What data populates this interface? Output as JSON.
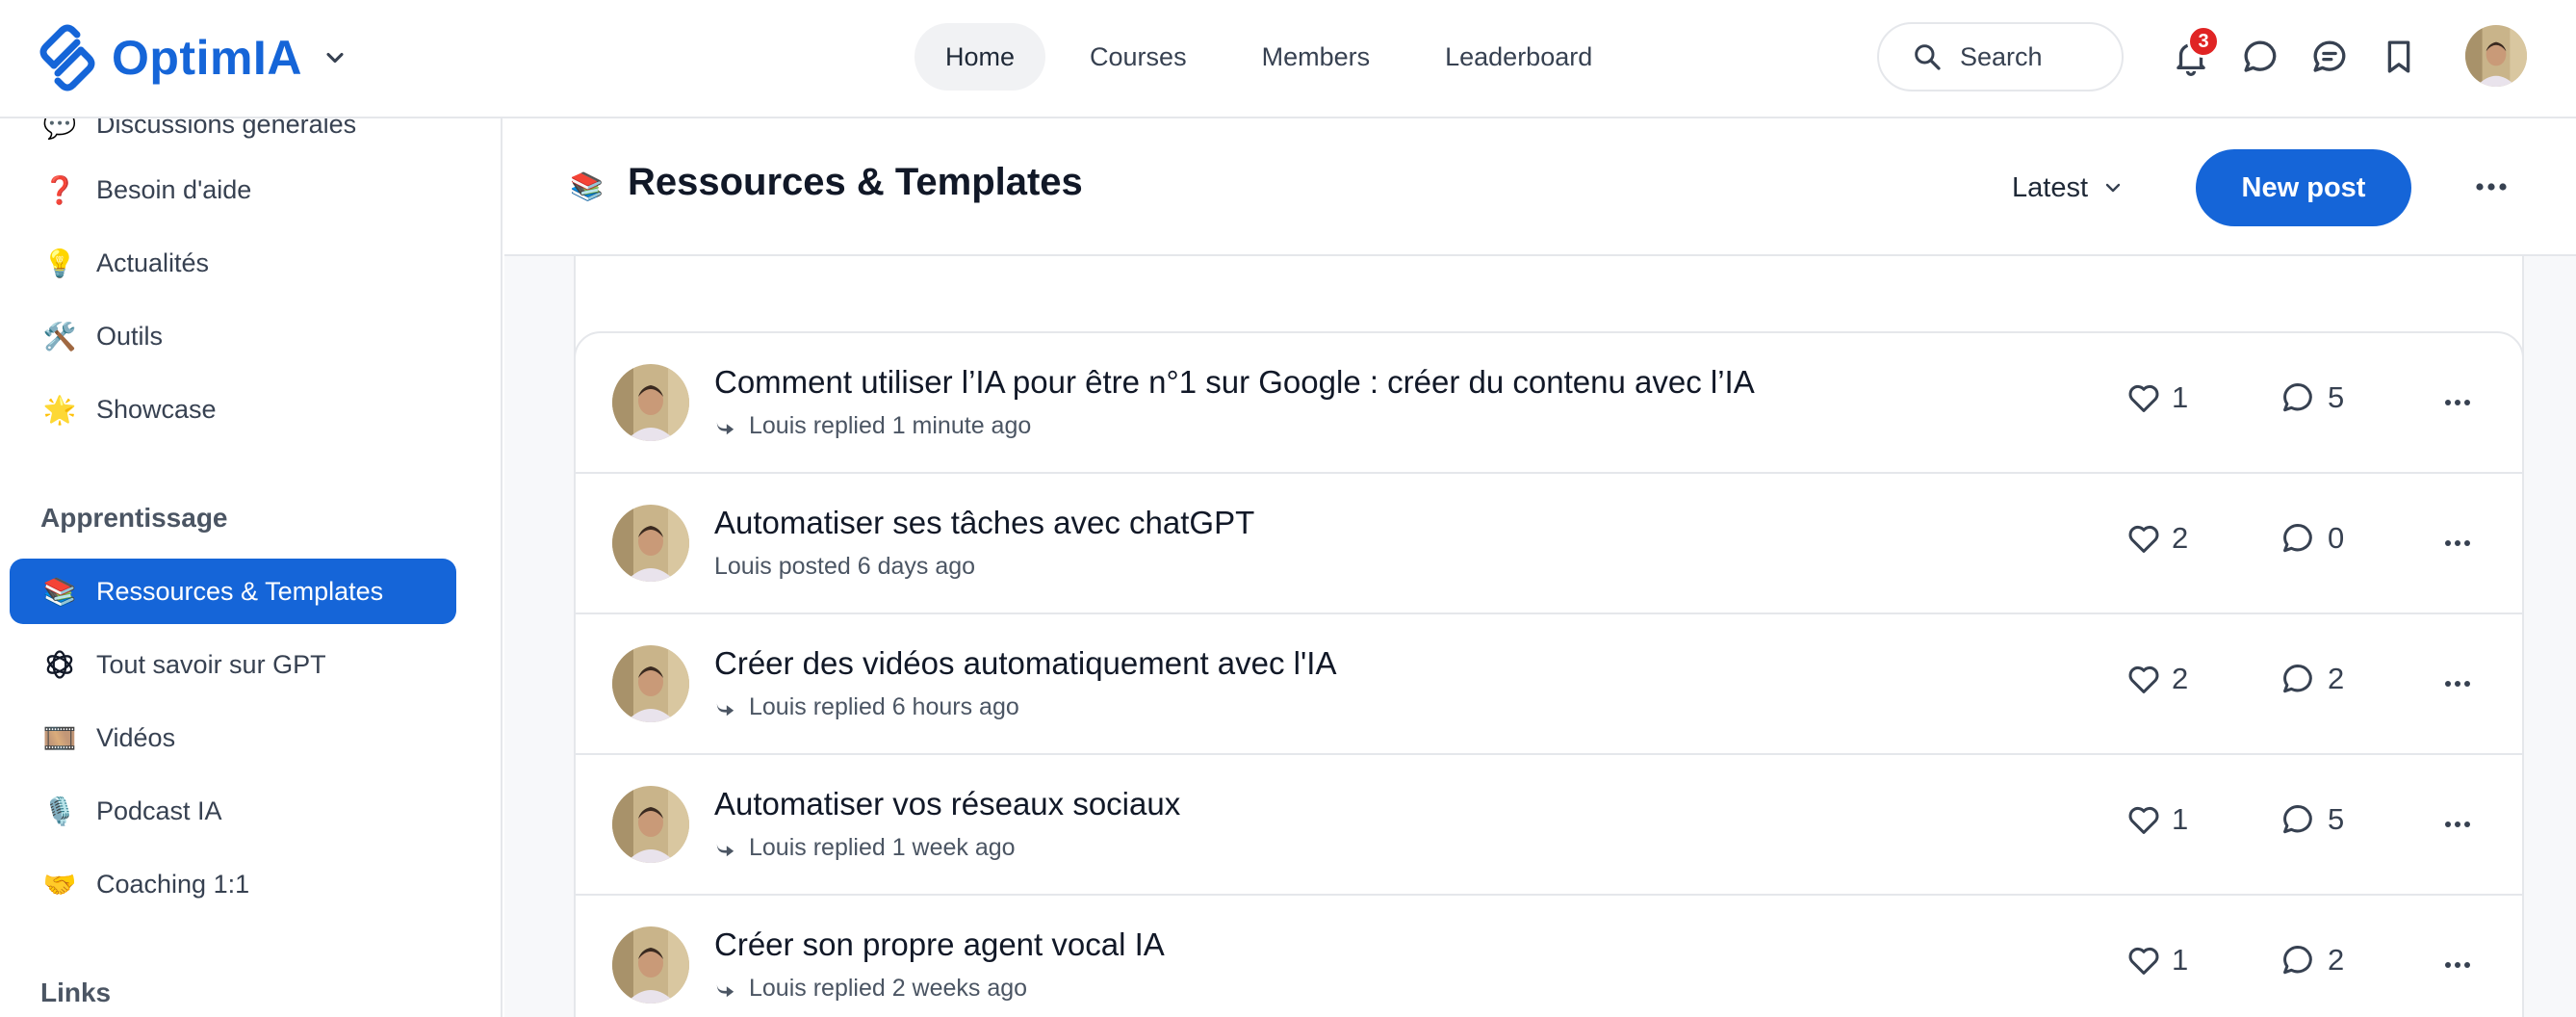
{
  "brand": {
    "name": "OptimIA",
    "color": "#1565d8"
  },
  "nav": {
    "items": [
      {
        "label": "Home",
        "active": true
      },
      {
        "label": "Courses",
        "active": false
      },
      {
        "label": "Members",
        "active": false
      },
      {
        "label": "Leaderboard",
        "active": false
      }
    ]
  },
  "search": {
    "label": "Search"
  },
  "header_icons": [
    "bell-icon",
    "chat-bubble-icon",
    "messages-icon",
    "bookmark-icon"
  ],
  "notifications": {
    "count": "3"
  },
  "sidebar": {
    "items": [
      {
        "emoji": "💬",
        "label": "Discussions générales"
      },
      {
        "emoji": "❓",
        "label": "Besoin d'aide"
      },
      {
        "emoji": "💡",
        "label": "Actualités"
      },
      {
        "emoji": "🛠️",
        "label": "Outils"
      },
      {
        "emoji": "🌟",
        "label": "Showcase"
      }
    ],
    "sections": [
      {
        "title": "Apprentissage",
        "items": [
          {
            "emoji": "📚",
            "label": "Ressources & Templates",
            "active": true
          },
          {
            "emoji": "openai-logo-icon",
            "label": "Tout savoir sur GPT"
          },
          {
            "emoji": "🎞️",
            "label": "Vidéos"
          },
          {
            "emoji": "🎙️",
            "label": "Podcast IA"
          },
          {
            "emoji": "🤝",
            "label": "Coaching 1:1"
          }
        ]
      },
      {
        "title": "Links"
      }
    ]
  },
  "space": {
    "emoji": "📚",
    "title": "Ressources & Templates",
    "sort_label": "Latest",
    "new_post_label": "New post"
  },
  "posts": [
    {
      "title": "Comment utiliser l’IA pour être n°1 sur Google : créer du contenu avec l’IA",
      "meta": "Louis replied 1 minute ago",
      "reply": true,
      "likes": "1",
      "comments": "5"
    },
    {
      "title": "Automatiser ses tâches avec chatGPT",
      "meta": "Louis posted 6 days ago",
      "reply": false,
      "likes": "2",
      "comments": "0"
    },
    {
      "title": "Créer des vidéos automatiquement avec l'IA",
      "meta": "Louis replied 6 hours ago",
      "reply": true,
      "likes": "2",
      "comments": "2"
    },
    {
      "title": "Automatiser vos réseaux sociaux",
      "meta": "Louis replied 1 week ago",
      "reply": true,
      "likes": "1",
      "comments": "5"
    },
    {
      "title": "Créer son propre agent vocal IA",
      "meta": "Louis replied 2 weeks ago",
      "reply": true,
      "likes": "1",
      "comments": "2"
    }
  ]
}
